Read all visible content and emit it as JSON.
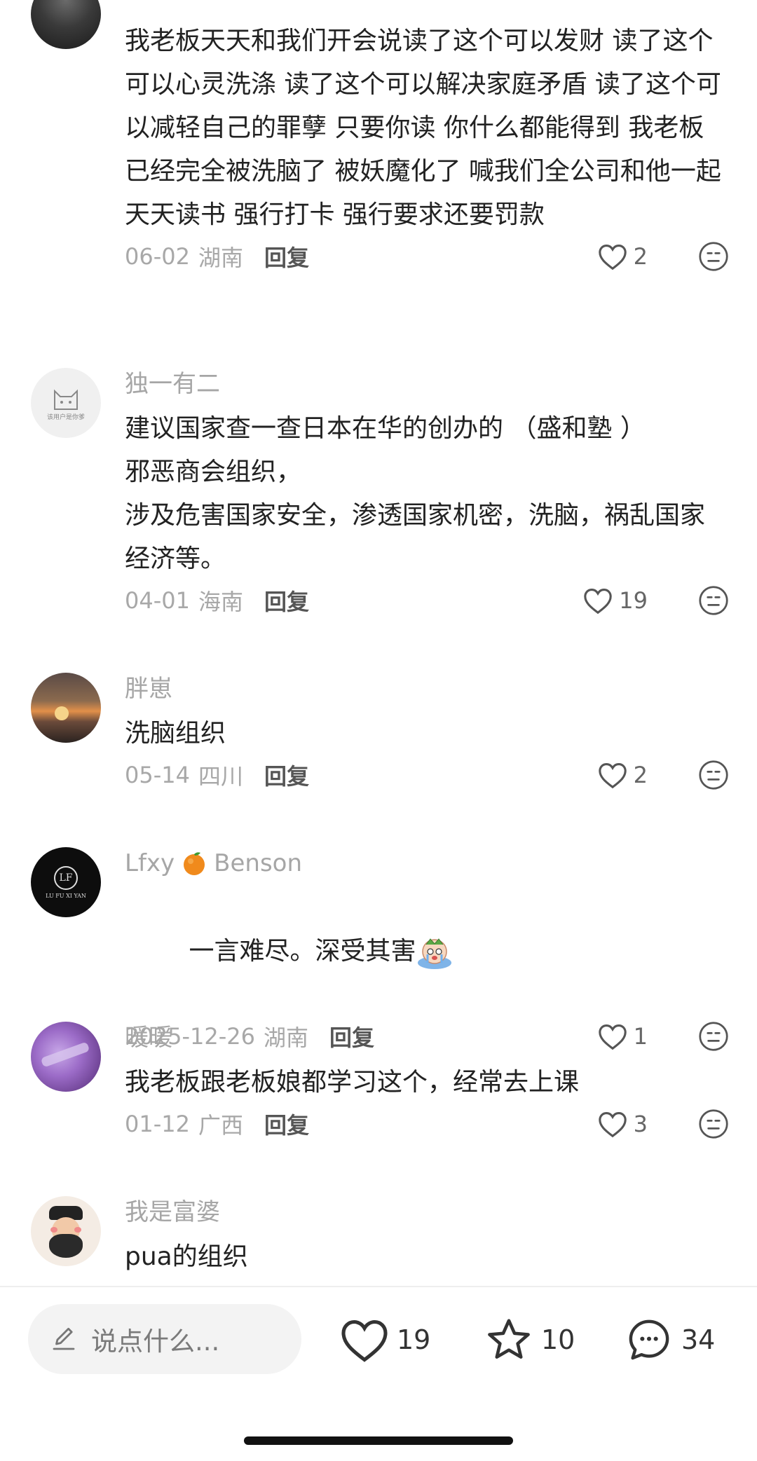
{
  "comments": [
    {
      "author": "",
      "text": "我老板天天和我们开会说读了这个可以发财 读了这个可以心灵洗涤 读了这个可以解决家庭矛盾 读了这个可以减轻自己的罪孽 只要你读 你什么都能得到 我老板已经完全被洗脑了 被妖魔化了 喊我们全公司和他一起天天读书 强行打卡 强行要求还要罚款",
      "date": "06-02",
      "location": "湖南",
      "reply": "回复",
      "likes": "2"
    },
    {
      "author": "独一有二",
      "avatar_text": "该用户是你爹",
      "text": "建议国家查一查日本在华的创办的 （盛和塾 ）\n邪恶商会组织，\n涉及危害国家安全，渗透国家机密，洗脑，祸乱国家经济等。",
      "date": "04-01",
      "location": "海南",
      "reply": "回复",
      "likes": "19"
    },
    {
      "author": "胖崽",
      "text": "洗脑组织",
      "date": "05-14",
      "location": "四川",
      "reply": "回复",
      "likes": "2"
    },
    {
      "author_first": "Lfxy",
      "author_second": "Benson",
      "avatar_text": "LU FU XI YAN",
      "text": "一言难尽。深受其害",
      "date": "2025-12-26",
      "location": "湖南",
      "reply": "回复",
      "likes": "1"
    },
    {
      "author": "暖暖",
      "text": "我老板跟老板娘都学习这个，经常去上课",
      "date": "01-12",
      "location": "广西",
      "reply": "回复",
      "likes": "3"
    },
    {
      "author": "我是富婆",
      "text": "pua的组织"
    }
  ],
  "bottom_bar": {
    "input_placeholder": "说点什么...",
    "likes": "19",
    "favorites": "10",
    "comments": "34"
  },
  "icons": [
    "heart-icon",
    "neutral-face-icon",
    "pencil-icon",
    "star-icon",
    "chat-bubble-icon",
    "orange-emoji-icon",
    "crying-emoji-icon"
  ],
  "colors": {
    "meta_text": "#a8a8a8",
    "author_text": "#a6a6a6",
    "body_text": "#222222"
  }
}
